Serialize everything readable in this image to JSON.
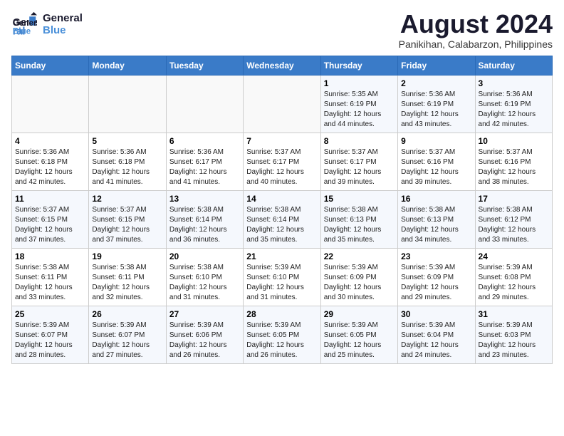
{
  "logo": {
    "line1": "General",
    "line2": "Blue"
  },
  "title": "August 2024",
  "subtitle": "Panikihan, Calabarzon, Philippines",
  "days_of_week": [
    "Sunday",
    "Monday",
    "Tuesday",
    "Wednesday",
    "Thursday",
    "Friday",
    "Saturday"
  ],
  "weeks": [
    [
      {
        "day": "",
        "info": ""
      },
      {
        "day": "",
        "info": ""
      },
      {
        "day": "",
        "info": ""
      },
      {
        "day": "",
        "info": ""
      },
      {
        "day": "1",
        "info": "Sunrise: 5:35 AM\nSunset: 6:19 PM\nDaylight: 12 hours\nand 44 minutes."
      },
      {
        "day": "2",
        "info": "Sunrise: 5:36 AM\nSunset: 6:19 PM\nDaylight: 12 hours\nand 43 minutes."
      },
      {
        "day": "3",
        "info": "Sunrise: 5:36 AM\nSunset: 6:19 PM\nDaylight: 12 hours\nand 42 minutes."
      }
    ],
    [
      {
        "day": "4",
        "info": "Sunrise: 5:36 AM\nSunset: 6:18 PM\nDaylight: 12 hours\nand 42 minutes."
      },
      {
        "day": "5",
        "info": "Sunrise: 5:36 AM\nSunset: 6:18 PM\nDaylight: 12 hours\nand 41 minutes."
      },
      {
        "day": "6",
        "info": "Sunrise: 5:36 AM\nSunset: 6:17 PM\nDaylight: 12 hours\nand 41 minutes."
      },
      {
        "day": "7",
        "info": "Sunrise: 5:37 AM\nSunset: 6:17 PM\nDaylight: 12 hours\nand 40 minutes."
      },
      {
        "day": "8",
        "info": "Sunrise: 5:37 AM\nSunset: 6:17 PM\nDaylight: 12 hours\nand 39 minutes."
      },
      {
        "day": "9",
        "info": "Sunrise: 5:37 AM\nSunset: 6:16 PM\nDaylight: 12 hours\nand 39 minutes."
      },
      {
        "day": "10",
        "info": "Sunrise: 5:37 AM\nSunset: 6:16 PM\nDaylight: 12 hours\nand 38 minutes."
      }
    ],
    [
      {
        "day": "11",
        "info": "Sunrise: 5:37 AM\nSunset: 6:15 PM\nDaylight: 12 hours\nand 37 minutes."
      },
      {
        "day": "12",
        "info": "Sunrise: 5:37 AM\nSunset: 6:15 PM\nDaylight: 12 hours\nand 37 minutes."
      },
      {
        "day": "13",
        "info": "Sunrise: 5:38 AM\nSunset: 6:14 PM\nDaylight: 12 hours\nand 36 minutes."
      },
      {
        "day": "14",
        "info": "Sunrise: 5:38 AM\nSunset: 6:14 PM\nDaylight: 12 hours\nand 35 minutes."
      },
      {
        "day": "15",
        "info": "Sunrise: 5:38 AM\nSunset: 6:13 PM\nDaylight: 12 hours\nand 35 minutes."
      },
      {
        "day": "16",
        "info": "Sunrise: 5:38 AM\nSunset: 6:13 PM\nDaylight: 12 hours\nand 34 minutes."
      },
      {
        "day": "17",
        "info": "Sunrise: 5:38 AM\nSunset: 6:12 PM\nDaylight: 12 hours\nand 33 minutes."
      }
    ],
    [
      {
        "day": "18",
        "info": "Sunrise: 5:38 AM\nSunset: 6:11 PM\nDaylight: 12 hours\nand 33 minutes."
      },
      {
        "day": "19",
        "info": "Sunrise: 5:38 AM\nSunset: 6:11 PM\nDaylight: 12 hours\nand 32 minutes."
      },
      {
        "day": "20",
        "info": "Sunrise: 5:38 AM\nSunset: 6:10 PM\nDaylight: 12 hours\nand 31 minutes."
      },
      {
        "day": "21",
        "info": "Sunrise: 5:39 AM\nSunset: 6:10 PM\nDaylight: 12 hours\nand 31 minutes."
      },
      {
        "day": "22",
        "info": "Sunrise: 5:39 AM\nSunset: 6:09 PM\nDaylight: 12 hours\nand 30 minutes."
      },
      {
        "day": "23",
        "info": "Sunrise: 5:39 AM\nSunset: 6:09 PM\nDaylight: 12 hours\nand 29 minutes."
      },
      {
        "day": "24",
        "info": "Sunrise: 5:39 AM\nSunset: 6:08 PM\nDaylight: 12 hours\nand 29 minutes."
      }
    ],
    [
      {
        "day": "25",
        "info": "Sunrise: 5:39 AM\nSunset: 6:07 PM\nDaylight: 12 hours\nand 28 minutes."
      },
      {
        "day": "26",
        "info": "Sunrise: 5:39 AM\nSunset: 6:07 PM\nDaylight: 12 hours\nand 27 minutes."
      },
      {
        "day": "27",
        "info": "Sunrise: 5:39 AM\nSunset: 6:06 PM\nDaylight: 12 hours\nand 26 minutes."
      },
      {
        "day": "28",
        "info": "Sunrise: 5:39 AM\nSunset: 6:05 PM\nDaylight: 12 hours\nand 26 minutes."
      },
      {
        "day": "29",
        "info": "Sunrise: 5:39 AM\nSunset: 6:05 PM\nDaylight: 12 hours\nand 25 minutes."
      },
      {
        "day": "30",
        "info": "Sunrise: 5:39 AM\nSunset: 6:04 PM\nDaylight: 12 hours\nand 24 minutes."
      },
      {
        "day": "31",
        "info": "Sunrise: 5:39 AM\nSunset: 6:03 PM\nDaylight: 12 hours\nand 23 minutes."
      }
    ]
  ]
}
